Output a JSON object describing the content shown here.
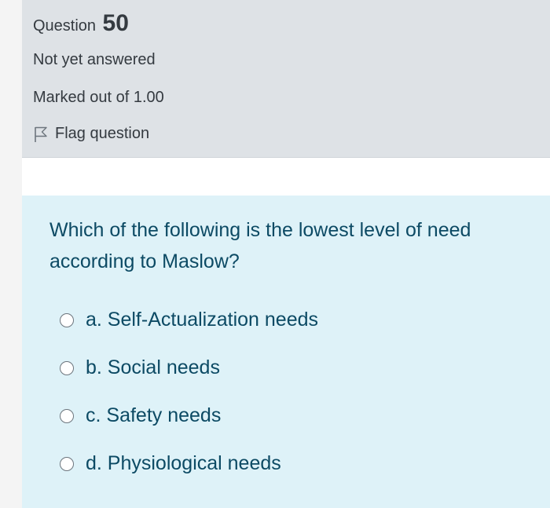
{
  "question_info": {
    "label": "Question",
    "number": "50",
    "state": "Not yet answered",
    "grade": "Marked out of 1.00",
    "flag_label": "Flag question",
    "flag_icon": "flag-outline-icon"
  },
  "question": {
    "text": "Which of the following is the lowest level of need according to Maslow?",
    "answers": [
      {
        "label": "a. Self-Actualization needs",
        "selected": false
      },
      {
        "label": "b. Social needs",
        "selected": false
      },
      {
        "label": "c. Safety needs",
        "selected": false
      },
      {
        "label": "d. Physiological needs",
        "selected": false
      }
    ]
  },
  "colors": {
    "info_bg": "#dee2e6",
    "content_bg": "#def2f8",
    "content_text": "#0c4a64",
    "info_text": "#343a40"
  }
}
